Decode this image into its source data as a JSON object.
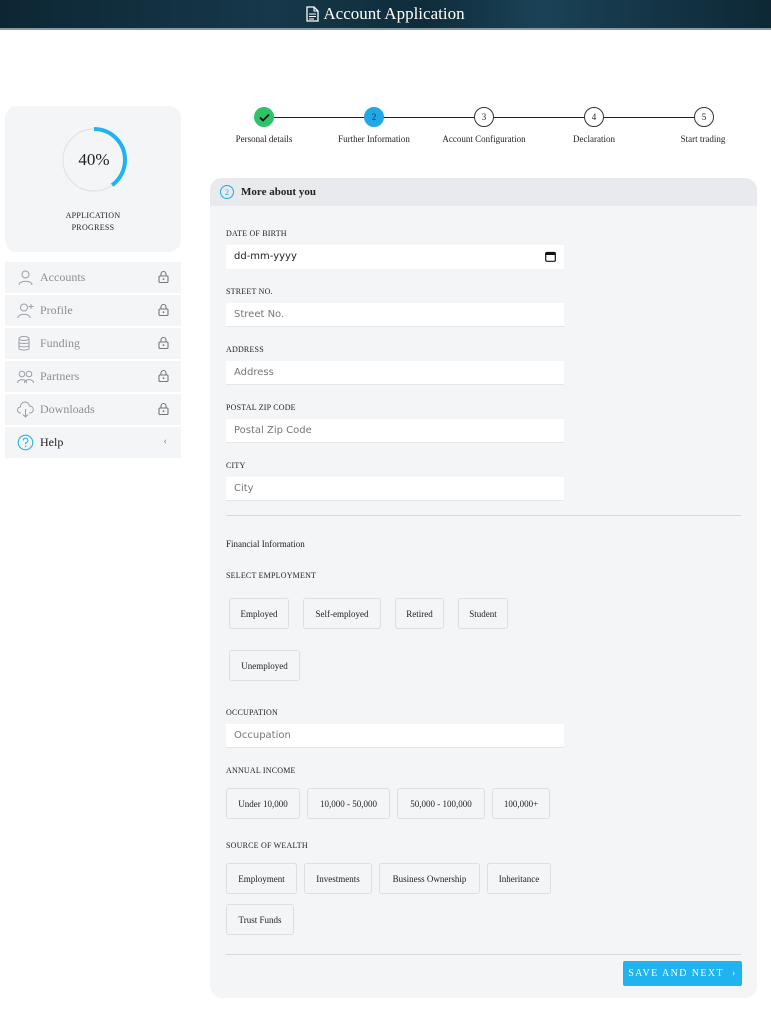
{
  "header": {
    "title": "Account Application",
    "icon": "document-icon"
  },
  "progress": {
    "value": 40,
    "percent_label": "40%",
    "label_line1": "APPLICATION",
    "label_line2": "PROGRESS",
    "color": "#1fb3f0"
  },
  "sidebar": {
    "items": [
      {
        "label": "Accounts",
        "icon": "user-icon",
        "locked": true
      },
      {
        "label": "Profile",
        "icon": "user-add-icon",
        "locked": true
      },
      {
        "label": "Funding",
        "icon": "coins-icon",
        "locked": true
      },
      {
        "label": "Partners",
        "icon": "users-icon",
        "locked": true
      },
      {
        "label": "Downloads",
        "icon": "cloud-download-icon",
        "locked": true
      },
      {
        "label": "Help",
        "icon": "help-icon",
        "locked": false
      }
    ]
  },
  "stepper": {
    "steps": [
      {
        "num": "",
        "label": "Personal details",
        "state": "done"
      },
      {
        "num": "2",
        "label": "Further Information",
        "state": "active"
      },
      {
        "num": "3",
        "label": "Account Configuration",
        "state": "pending"
      },
      {
        "num": "4",
        "label": "Declaration",
        "state": "pending"
      },
      {
        "num": "5",
        "label": "Start trading",
        "state": "pending"
      }
    ]
  },
  "form": {
    "section_number": "2",
    "title": "More about you",
    "dob": {
      "label": "DATE OF BIRTH",
      "value": "dd-mm-yyyy"
    },
    "street": {
      "label": "STREET NO.",
      "placeholder": "Street No."
    },
    "address": {
      "label": "ADDRESS",
      "placeholder": "Address"
    },
    "postal": {
      "label": "POSTAL ZIP CODE",
      "placeholder": "Postal Zip Code"
    },
    "city": {
      "label": "CITY",
      "placeholder": "City"
    },
    "financial_title": "Financial Information",
    "employment": {
      "label": "SELECT EMPLOYMENT",
      "options": [
        "Employed",
        "Self-employed",
        "Retired",
        "Student",
        "Unemployed"
      ]
    },
    "occupation": {
      "label": "OCCUPATION",
      "placeholder": "Occupation"
    },
    "income": {
      "label": "ANNUAL INCOME",
      "options": [
        "Under 10,000",
        "10,000 - 50,000",
        "50,000 - 100,000",
        "100,000+"
      ]
    },
    "wealth": {
      "label": "SOURCE OF WEALTH",
      "options": [
        "Employment",
        "Investments",
        "Business Ownership",
        "Inheritance",
        "Trust Funds"
      ]
    },
    "save_label": "SAVE AND NEXT"
  },
  "colors": {
    "accent": "#1fb3f0",
    "success": "#2ec26a",
    "header_bg": "#0f2c3b"
  }
}
